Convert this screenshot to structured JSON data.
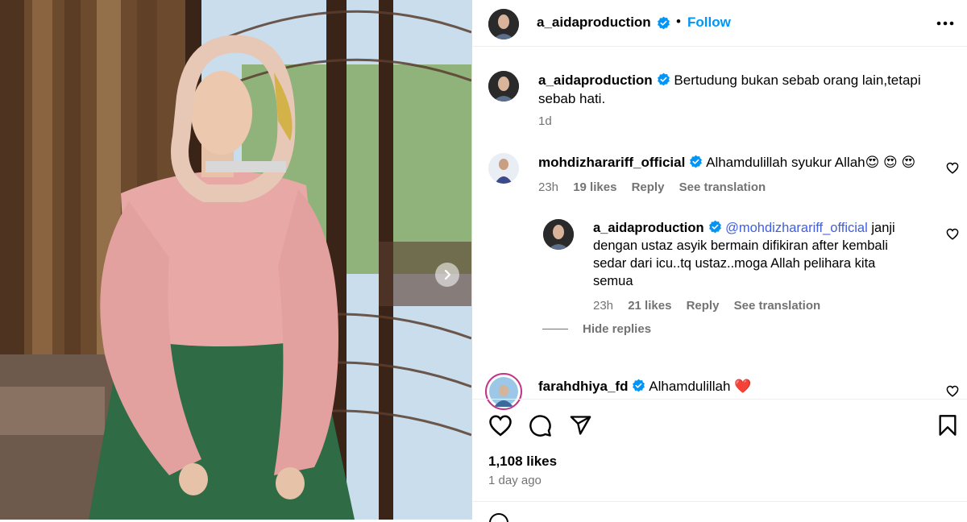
{
  "post": {
    "username": "a_aidaproduction",
    "separator": "•",
    "follow_label": "Follow",
    "more_icon": "more-horizontal-icon"
  },
  "caption": {
    "username": "a_aidaproduction",
    "text_line1": "Bertudung bukan sebab orang lain,tetapi",
    "text_line2": "sebab hati.",
    "time": "1d"
  },
  "comments": [
    {
      "username": "mohdizharariff_official",
      "text": "Alhamdulillah syukur Allah😍 😍 😍",
      "time": "23h",
      "likes": "19 likes",
      "reply_label": "Reply",
      "translate_label": "See translation"
    },
    {
      "username": "farahdhiya_fd",
      "text": "Alhamdulillah ❤️"
    }
  ],
  "reply": {
    "username": "a_aidaproduction",
    "mention": "@mohdizharariff_official",
    "text_line1": " janji",
    "text_line2": "dengan ustaz asyik bermain difikiran after kembali",
    "text_line3": "sedar dari icu..tq ustaz..moga Allah pelihara kita",
    "text_line4": "semua",
    "time": "23h",
    "likes": "21 likes",
    "reply_label": "Reply",
    "translate_label": "See translation",
    "hide_replies": "Hide replies"
  },
  "footer": {
    "likes": "1,108 likes",
    "ago": "1 day ago"
  },
  "colors": {
    "link": "#0095f6",
    "mention": "#3f5ee0",
    "verified": "#0095f6",
    "muted": "#737373"
  }
}
